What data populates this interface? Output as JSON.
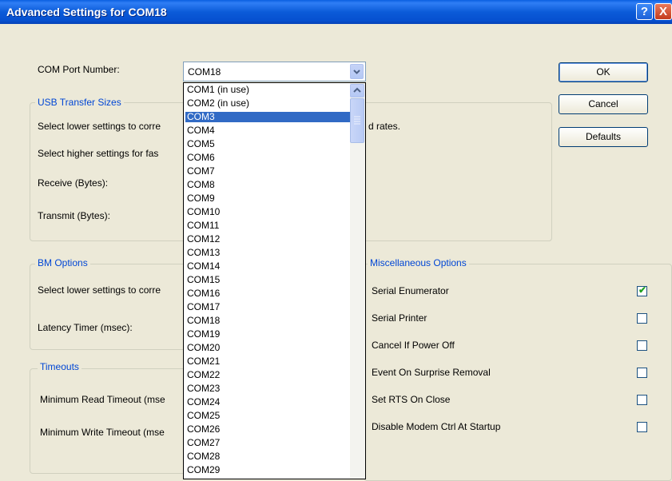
{
  "window": {
    "title": "Advanced Settings for COM18",
    "help_label": "?",
    "close_label": "X"
  },
  "com_port": {
    "label": "COM Port Number:",
    "value": "COM18"
  },
  "dropdown": {
    "selected_index": 2,
    "items": [
      "COM1 (in use)",
      "COM2 (in use)",
      "COM3",
      "COM4",
      "COM5",
      "COM6",
      "COM7",
      "COM8",
      "COM9",
      "COM10",
      "COM11",
      "COM12",
      "COM13",
      "COM14",
      "COM15",
      "COM16",
      "COM17",
      "COM18",
      "COM19",
      "COM20",
      "COM21",
      "COM22",
      "COM23",
      "COM24",
      "COM25",
      "COM26",
      "COM27",
      "COM28",
      "COM29"
    ]
  },
  "usb_transfer": {
    "legend": "USB Transfer Sizes",
    "line1": "Select lower settings to corre",
    "line1_tail": "d rates.",
    "line2": "Select higher settings for fas",
    "receive_label": "Receive (Bytes):",
    "transmit_label": "Transmit (Bytes):"
  },
  "bm_options": {
    "legend": "BM Options",
    "line1": "Select lower settings to corre",
    "latency_label": "Latency Timer (msec):"
  },
  "timeouts": {
    "legend": "Timeouts",
    "min_read_label": "Minimum Read Timeout (mse",
    "min_write_label": "Minimum Write Timeout (mse"
  },
  "misc": {
    "legend": "Miscellaneous Options",
    "options": [
      {
        "label": "Serial Enumerator",
        "checked": true
      },
      {
        "label": "Serial Printer",
        "checked": false
      },
      {
        "label": "Cancel If Power Off",
        "checked": false
      },
      {
        "label": "Event On Surprise Removal",
        "checked": false
      },
      {
        "label": "Set RTS On Close",
        "checked": false
      },
      {
        "label": "Disable Modem Ctrl At Startup",
        "checked": false
      }
    ]
  },
  "buttons": {
    "ok": "OK",
    "cancel": "Cancel",
    "defaults": "Defaults"
  },
  "colors": {
    "selection": "#316ac5",
    "legend": "#0046d5",
    "titlebar": "#0b5bd8"
  }
}
